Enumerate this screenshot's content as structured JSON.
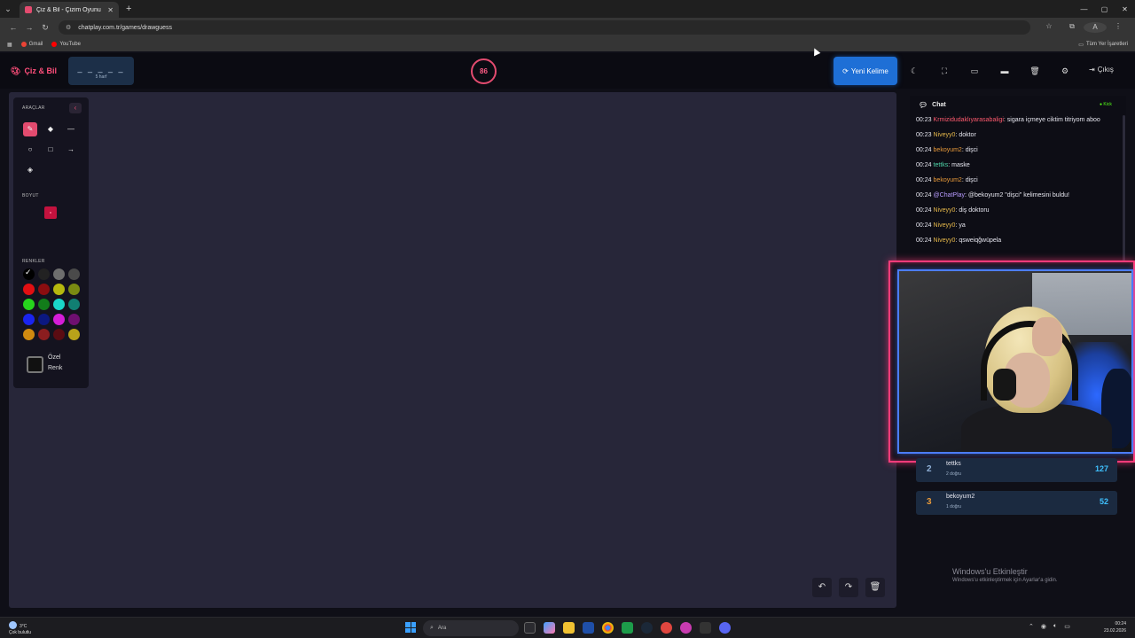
{
  "browser": {
    "tab_title": "Çiz & Bil - Çizim Oyunu",
    "url": "chatplay.com.tr/games/drawguess",
    "bookmarks": [
      "Gmail",
      "YouTube"
    ],
    "all_bookmarks": "Tüm Yer İşaretleri",
    "profile_initial": "A"
  },
  "header": {
    "logo": "Çiz & Bil",
    "word_blanks": "_ _ _ _ _",
    "word_hint": "5 harf",
    "timer": "86",
    "new_word": "Yeni Kelime",
    "logout": "Çıkış",
    "accent": "#e34b6f",
    "button_color": "#1e6fd6"
  },
  "tools": {
    "title": "ARAÇLAR",
    "size_label": "BOYUT",
    "colors_label": "RENKLER",
    "custom_color": "Özel Renk",
    "palette": [
      "#000000",
      "#222222",
      "#6e6e6e",
      "#4a4a4a",
      "#e10f12",
      "#8b0d10",
      "#b5b80e",
      "#7a8a12",
      "#26d41c",
      "#127c1a",
      "#1ad6c9",
      "#117f72",
      "#1a24ee",
      "#0b1880",
      "#d51dd8",
      "#6e0f70",
      "#d08a10",
      "#8b1d1f",
      "#5a0c12",
      "#b8a21a"
    ]
  },
  "chat": {
    "title": "Chat",
    "platform": "Kick",
    "messages": [
      {
        "time": "00:23",
        "user": "Krmizidudaklıyarasabaligi",
        "user_color": "#ff5a6e",
        "text": ": sigara içmeye ciktim titriyom aboo"
      },
      {
        "time": "00:23",
        "user": "Niveyy0",
        "user_color": "#e6b84a",
        "text": ": doktor"
      },
      {
        "time": "00:24",
        "user": "bekoyum2",
        "user_color": "#e89a3a",
        "text": ": dişci"
      },
      {
        "time": "00:24",
        "user": "tettks",
        "user_color": "#4fd6a9",
        "text": ": maske"
      },
      {
        "time": "00:24",
        "user": "bekoyum2",
        "user_color": "#e89a3a",
        "text": ": dişci"
      },
      {
        "time": "00:24",
        "user": "@ChatPlay",
        "user_color": "#b89cff",
        "text": ": @bekoyum2 \"dişci\" kelimesini buldu!"
      },
      {
        "time": "00:24",
        "user": "Niveyy0",
        "user_color": "#e6b84a",
        "text": ": diş doktoru"
      },
      {
        "time": "00:24",
        "user": "Niveyy0",
        "user_color": "#e6b84a",
        "text": ": ya"
      },
      {
        "time": "00:24",
        "user": "Niveyy0",
        "user_color": "#e6b84a",
        "text": ": qsweiqğwüpela"
      }
    ]
  },
  "leaderboard": [
    {
      "rank": "2",
      "name": "tettks",
      "sub": "2 doğru",
      "score": "127",
      "rank_color": "#8fb0d6"
    },
    {
      "rank": "3",
      "name": "bekoyum2",
      "sub": "1 doğru",
      "score": "52",
      "rank_color": "#e89a3a"
    }
  ],
  "watermark": {
    "line1": "Windows'u Etkinleştir",
    "line2": "Windows'u etkinleştirmek için Ayarlar'a gidin."
  },
  "taskbar": {
    "weather_temp": "3°C",
    "weather_desc": "Çok bulutlu",
    "search": "Ara",
    "time": "00:24",
    "date": "23.02.2026"
  }
}
